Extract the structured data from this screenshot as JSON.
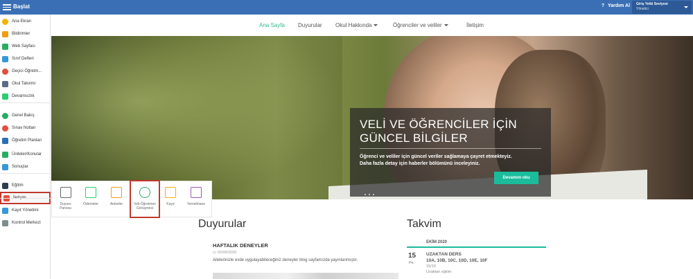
{
  "topbar": {
    "brand": "Başlat",
    "help": "Yardım Al",
    "role_title": "Giriş Yetki Seviyesi",
    "role_value": "Yönetici"
  },
  "sidebar": {
    "items": [
      {
        "label": "Ana Ekran",
        "icon": "star-icon",
        "color": "#f5b400"
      },
      {
        "label": "Bildirimler",
        "icon": "envelope-icon",
        "color": "#f39c12"
      },
      {
        "label": "Web Sayfası",
        "icon": "home-icon",
        "color": "#27ae60"
      },
      {
        "label": "Sınıf Defteri",
        "icon": "book-icon",
        "color": "#3498db"
      },
      {
        "label": "Geçici Öğretm...",
        "icon": "user-icon",
        "color": "#e74c3c"
      },
      {
        "label": "Okul Takvimi",
        "icon": "calendar-icon",
        "color": "#5b6b8a"
      },
      {
        "label": "Devamsızlık",
        "icon": "person-icon",
        "color": "#2ecc71"
      },
      {
        "label": "Genel Bakış",
        "icon": "check-circle-icon",
        "color": "#27ae60"
      },
      {
        "label": "Sınav Notları",
        "icon": "grade-icon",
        "color": "#e74c3c"
      },
      {
        "label": "Öğretim Planları",
        "icon": "plan-icon",
        "color": "#2c6fb6"
      },
      {
        "label": "Üniteler/Konular",
        "icon": "shield-icon",
        "color": "#27ae60"
      },
      {
        "label": "Sonuçlar",
        "icon": "bar-chart-icon",
        "color": "#3498db"
      },
      {
        "label": "Eğitim",
        "icon": "teach-icon",
        "color": "#2c3e50"
      },
      {
        "label": "İletişim",
        "icon": "chat-icon",
        "color": "#e74c3c"
      },
      {
        "label": "Kayıt Yönetimi",
        "icon": "pen-icon",
        "color": "#3498db"
      },
      {
        "label": "Kontrol Merkezi",
        "icon": "gear-icon",
        "color": "#7f8c8d"
      }
    ],
    "active_index": 13
  },
  "nav": {
    "items": [
      "Ana Sayfa",
      "Duyurular",
      "Okul Hakkında",
      "Öğrenciler ve veliler",
      "İletişim"
    ]
  },
  "hero": {
    "title_line1": "VELİ VE ÖĞRENCİLER İÇİN",
    "title_line2": "GÜNCEL BİLGİLER",
    "text_line1": "Öğrenci ve veliler için güncel veriler sağlamaya çayret etmekteyiz.",
    "text_line2": "Daha fazla detay için haberler bölümünü inceleyiniz.",
    "button": "Devamını oku"
  },
  "tiles": [
    {
      "label": "Duyuru Panosu",
      "icon": "board-icon",
      "color": "#666"
    },
    {
      "label": "Ödemeler",
      "icon": "payment-icon",
      "color": "#2ecc71"
    },
    {
      "label": "Anketler",
      "icon": "survey-icon",
      "color": "#f39c12"
    },
    {
      "label": "Veli-Öğretmen Görüşmesi",
      "icon": "clock-icon",
      "color": "#27ae60"
    },
    {
      "label": "Kayıt",
      "icon": "clipboard-icon",
      "color": "#f5b400"
    },
    {
      "label": "Yemekhane",
      "icon": "utensils-icon",
      "color": "#9b59b6"
    }
  ],
  "announcements": {
    "title": "Duyurular",
    "item_title": "HAFTALIK DENEYLER",
    "date": "02/06/2020",
    "body": "Ailelerinizle evde uygulayabileceğiniz deneyler blog sayfamızda yayınlanmıştır."
  },
  "calendar": {
    "title": "Takvim",
    "month": "EKİM 2020",
    "day": "15",
    "weekday": "Pe",
    "event_title": "UZAKTAN DERS",
    "event_classes": "10A, 10B, 10C, 10D, 10E, 10F",
    "event_date": "15/10",
    "event_note": "Uzaktan eğitim"
  }
}
